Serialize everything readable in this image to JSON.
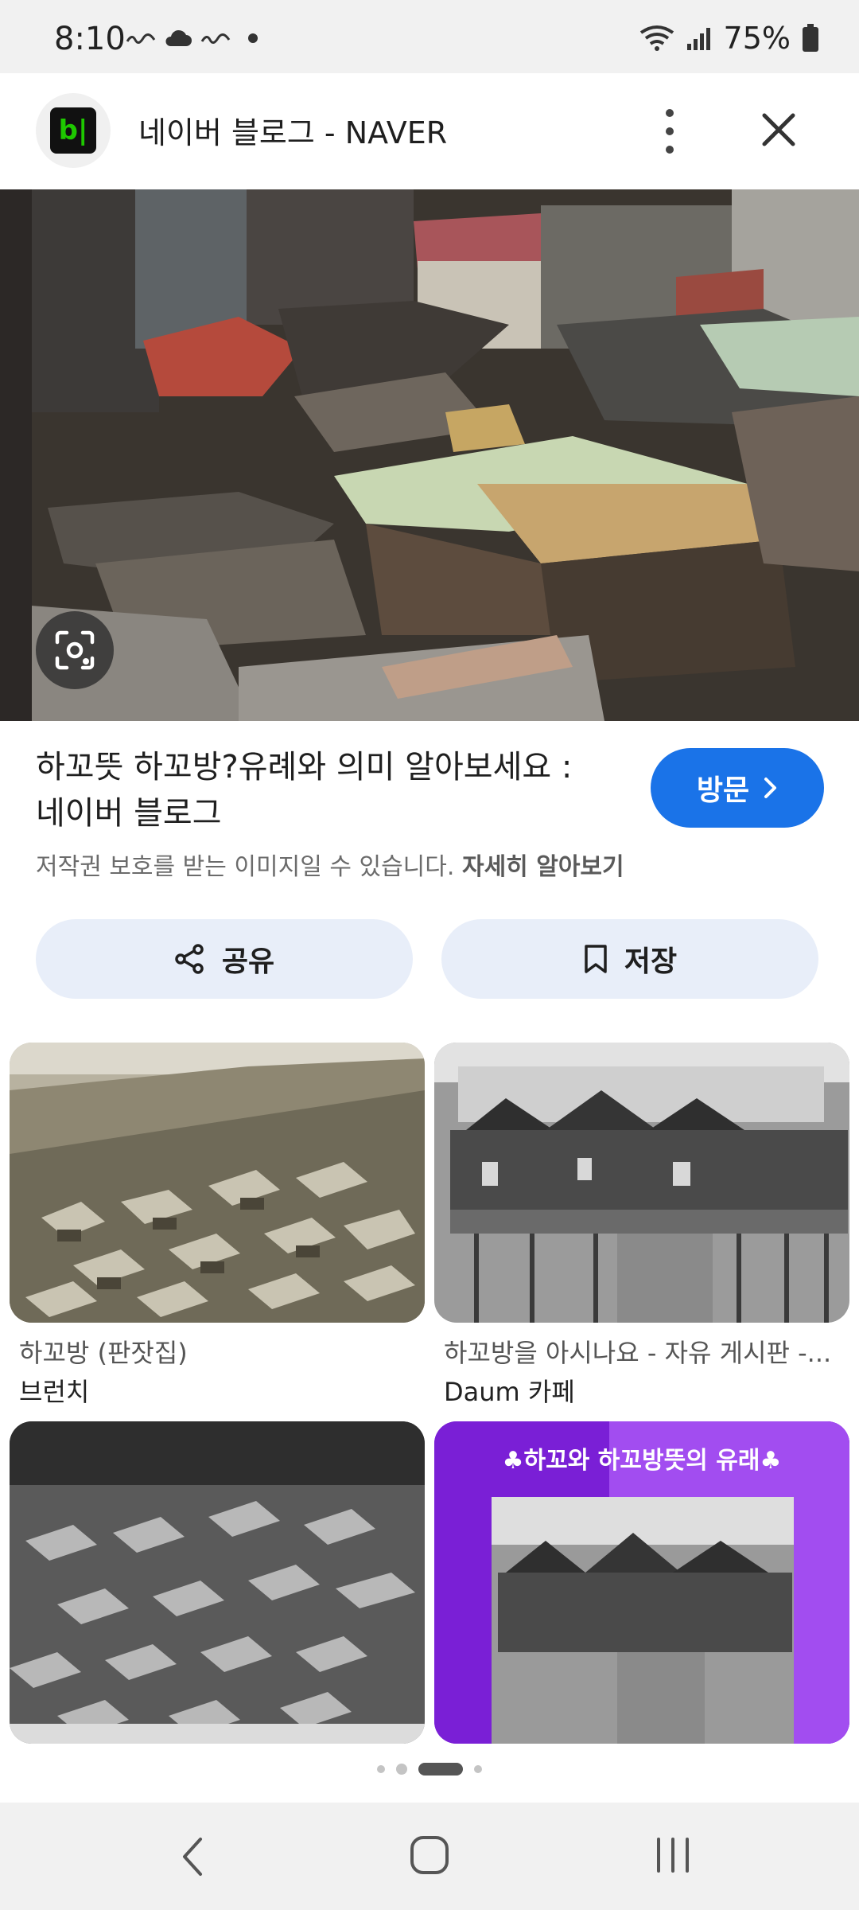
{
  "status": {
    "time": "8:10",
    "battery": "75%"
  },
  "header": {
    "app_icon_text": "b|",
    "title": "네이버 블로그 - NAVER"
  },
  "result": {
    "title_line1": "하꼬뜻 하꼬방?유례와 의미 알아보세요 :",
    "title_line2": "네이버 블로그",
    "visit_label": "방문",
    "copyright_text": "저작권 보호를 받는 이미지일 수 있습니다.",
    "copyright_link": "자세히 알아보기",
    "share_label": "공유",
    "save_label": "저장"
  },
  "grid": [
    {
      "caption": "하꼬방 (판잣집)",
      "source": "브런치"
    },
    {
      "caption": "하꼬방을 아시나요 - 자유 게시판 -...",
      "source": "Daum 카페"
    },
    {
      "caption": "",
      "source": ""
    },
    {
      "caption": "",
      "source": "",
      "overlay_text": "♣하꼬와 하꼬방뜻의 유래♣"
    }
  ],
  "colors": {
    "accent": "#1a73e8",
    "button_bg": "#e8eef9",
    "purple": "#8a2be2"
  }
}
